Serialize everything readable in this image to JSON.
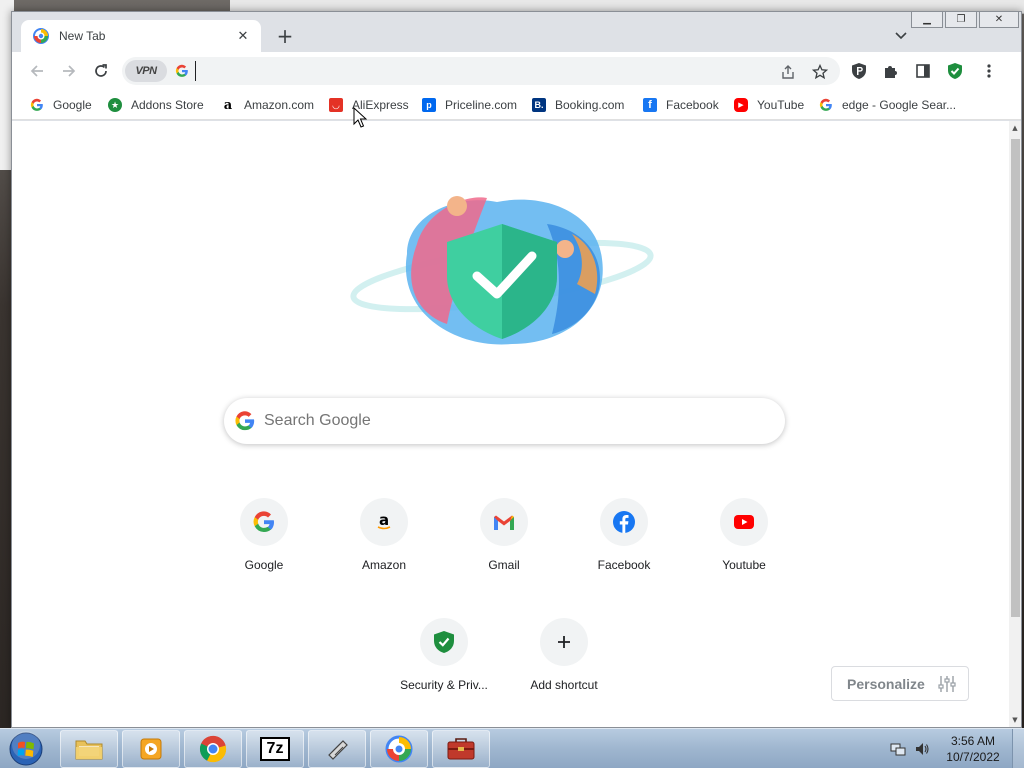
{
  "browser": {
    "tab": {
      "title": "New Tab",
      "close_glyph": "✕"
    },
    "new_tab_glyph": "+",
    "window_controls": {
      "minimize": "▁",
      "restore": "❐",
      "close": "✕"
    },
    "omnibox": {
      "vpn_label": "VPN",
      "value": ""
    },
    "bookmarks": [
      {
        "label": "Google",
        "icon": "google-icon",
        "color": "#4285f4"
      },
      {
        "label": "Addons Store",
        "icon": "addons-store-icon",
        "color": "#1e8e3e"
      },
      {
        "label": "Amazon.com",
        "icon": "amazon-icon",
        "color": "#000000"
      },
      {
        "label": "AliExpress",
        "icon": "aliexpress-icon",
        "color": "#e43225"
      },
      {
        "label": "Priceline.com",
        "icon": "priceline-icon",
        "color": "#0068ef"
      },
      {
        "label": "Booking.com",
        "icon": "booking-icon",
        "color": "#003580"
      },
      {
        "label": "Facebook",
        "icon": "facebook-icon",
        "color": "#1877f2"
      },
      {
        "label": "YouTube",
        "icon": "youtube-icon",
        "color": "#ff0000"
      },
      {
        "label": "edge - Google Sear...",
        "icon": "google-icon",
        "color": "#4285f4"
      }
    ]
  },
  "newtab": {
    "search_placeholder": "Search Google",
    "shortcuts": [
      {
        "label": "Google",
        "icon": "google-icon"
      },
      {
        "label": "Amazon",
        "icon": "amazon-icon"
      },
      {
        "label": "Gmail",
        "icon": "gmail-icon"
      },
      {
        "label": "Facebook",
        "icon": "facebook-icon"
      },
      {
        "label": "Youtube",
        "icon": "youtube-icon"
      },
      {
        "label": "Security & Priv...",
        "icon": "security-shield-icon"
      },
      {
        "label": "Add shortcut",
        "icon": "plus-icon"
      }
    ],
    "personalize_label": "Personalize"
  },
  "taskbar": {
    "items": [
      {
        "name": "windows-explorer",
        "icon": "folder-icon"
      },
      {
        "name": "media-player",
        "icon": "media-player-icon"
      },
      {
        "name": "chrome",
        "icon": "chrome-icon"
      },
      {
        "name": "7zip",
        "icon": "7zip-icon",
        "label": "7z"
      },
      {
        "name": "tool",
        "icon": "tool-icon"
      },
      {
        "name": "browser-alt",
        "icon": "browser-alt-icon"
      },
      {
        "name": "toolbox",
        "icon": "toolbox-icon"
      }
    ],
    "clock": {
      "time": "3:56 AM",
      "date": "10/7/2022"
    }
  },
  "colors": {
    "accent_blue": "#1a73e8",
    "shield_green": "#1e8e3e",
    "taskbar": "#9fb6cf"
  }
}
